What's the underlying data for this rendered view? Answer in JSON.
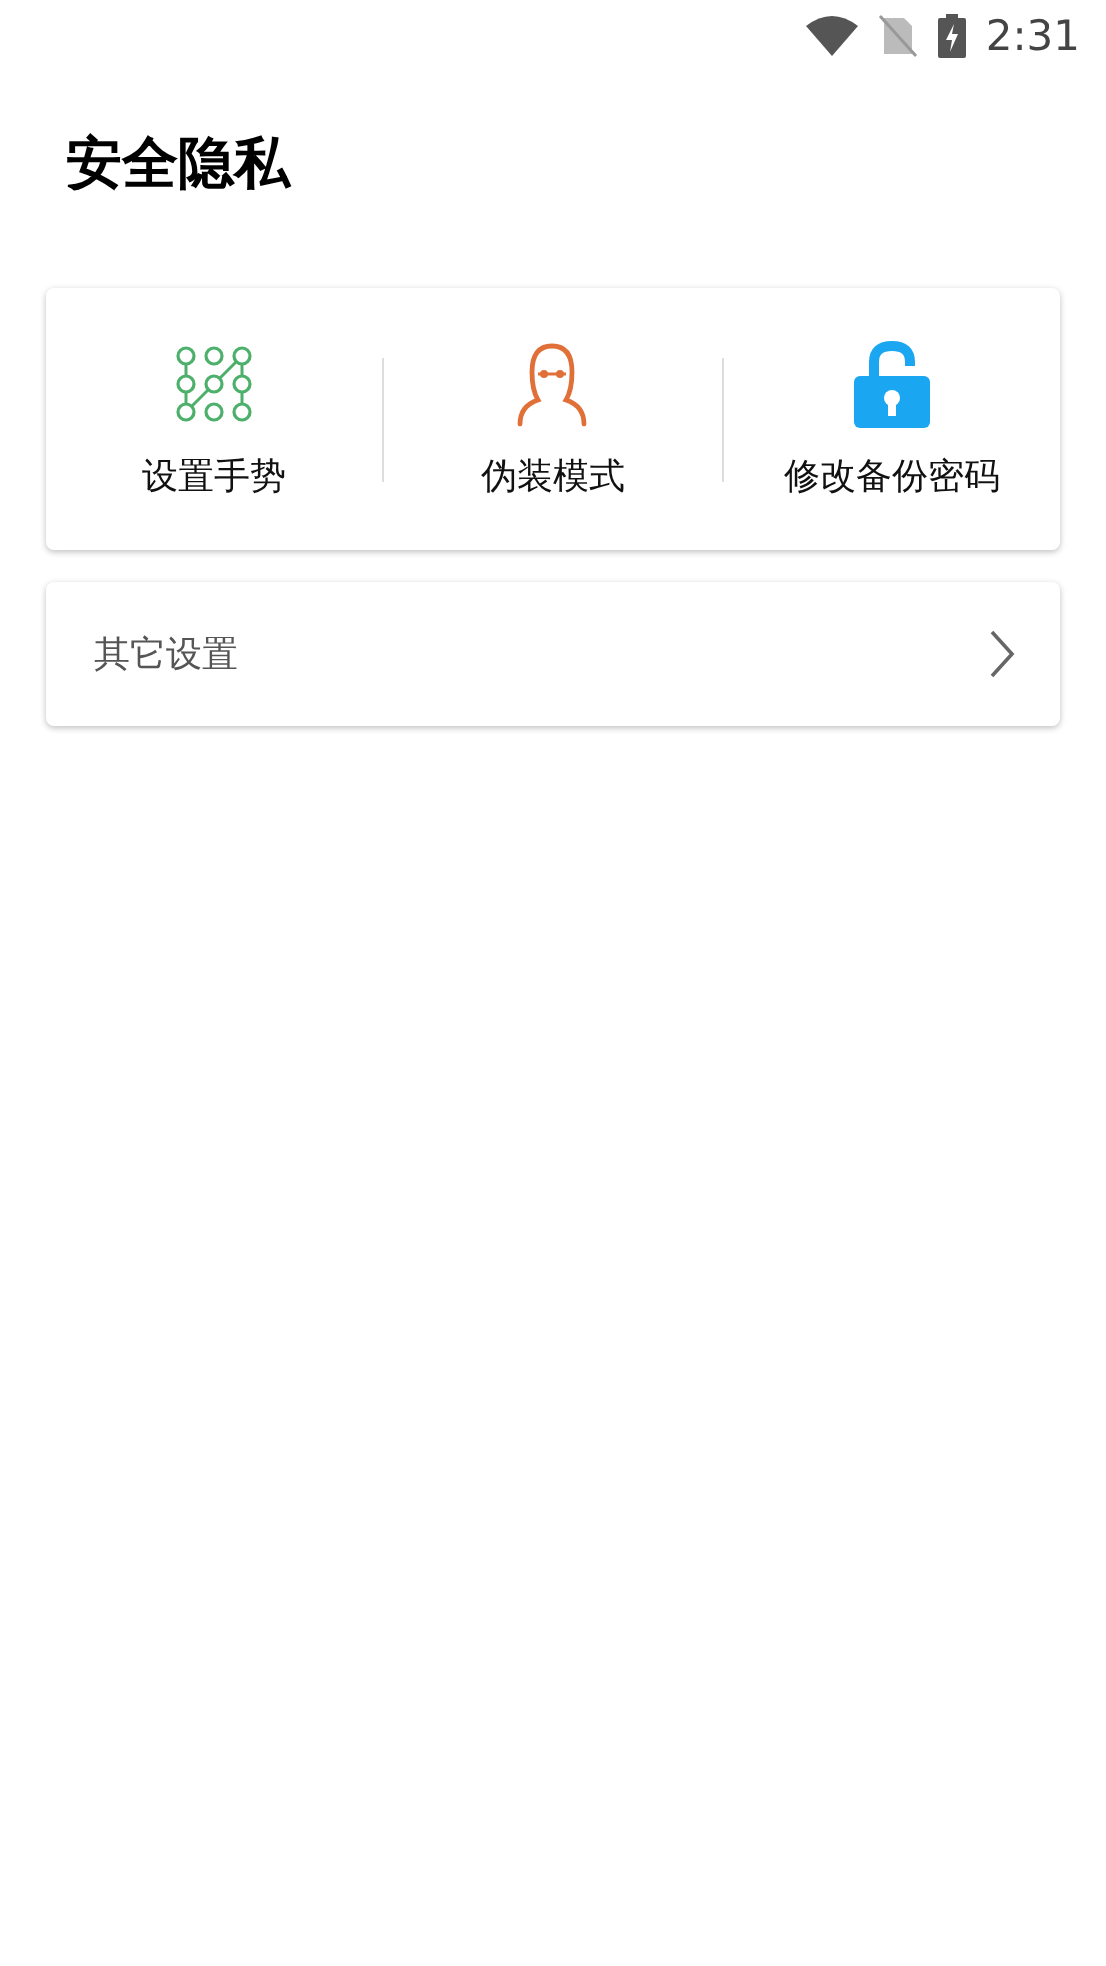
{
  "status_bar": {
    "time": "2:31"
  },
  "title": "安全隐私",
  "actions": [
    {
      "kind": "pattern",
      "label": "设置手势"
    },
    {
      "kind": "disguise",
      "label": "伪装模式"
    },
    {
      "kind": "lock",
      "label": "修改备份密码"
    }
  ],
  "other_settings": {
    "label": "其它设置"
  }
}
